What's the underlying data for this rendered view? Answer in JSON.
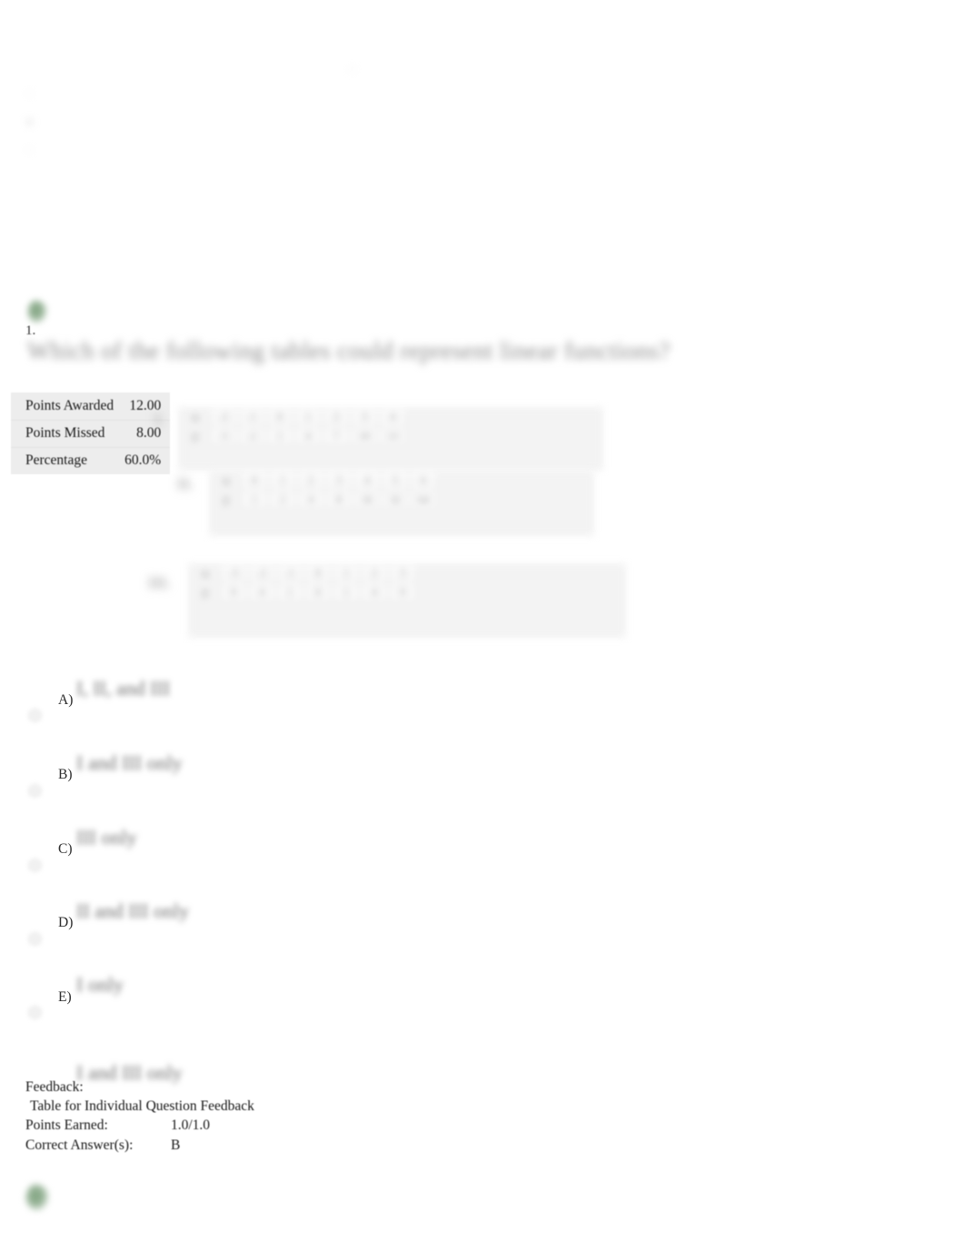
{
  "document": {
    "type": "quiz-review",
    "background_color": "#ffffff"
  },
  "top_artifacts": {
    "center_mark": "▫",
    "left_marks": [
      "▫",
      "▪",
      "▫"
    ]
  },
  "score_summary": {
    "rows": [
      {
        "label": "Points Awarded",
        "value": "12.00"
      },
      {
        "label": "Points Missed",
        "value": "8.00"
      },
      {
        "label": "Percentage",
        "value": "60.0%"
      }
    ]
  },
  "status_icons": {
    "top": "correct-check-icon",
    "bottom": "correct-check-icon",
    "color": "#8aab8a"
  },
  "question": {
    "number": "1.",
    "text": "Which of the following tables could represent linear functions?",
    "figures": [
      {
        "label": "I.",
        "rows": [
          [
            "x",
            "-2",
            "-1",
            "0",
            "1",
            "2",
            "3",
            "4"
          ],
          [
            "y",
            "-5",
            "-2",
            "1",
            "4",
            "7",
            "10",
            "13"
          ]
        ]
      },
      {
        "label": "II.",
        "rows": [
          [
            "x",
            "0",
            "1",
            "2",
            "3",
            "4",
            "5",
            "6"
          ],
          [
            "y",
            "1",
            "2",
            "4",
            "8",
            "16",
            "32",
            "64"
          ]
        ]
      },
      {
        "label": "III.",
        "rows": [
          [
            "x",
            "-3",
            "-2",
            "-1",
            "0",
            "1",
            "2",
            "3"
          ],
          [
            "y",
            "9",
            "4",
            "1",
            "0",
            "1",
            "4",
            "9"
          ]
        ]
      }
    ]
  },
  "options": [
    {
      "letter": "A)",
      "text": "I, II, and III",
      "selected": false
    },
    {
      "letter": "B)",
      "text": "I and III only",
      "selected": true
    },
    {
      "letter": "C)",
      "text": "III only",
      "selected": false
    },
    {
      "letter": "D)",
      "text": "II and III only",
      "selected": false
    },
    {
      "letter": "E)",
      "text": "I only",
      "selected": false
    }
  ],
  "selected_answer_echo": "I and III only",
  "feedback": {
    "heading": "Feedback:",
    "table_caption": " Table for Individual Question Feedback",
    "points_earned_label": "Points Earned:",
    "points_earned_value": "1.0/1.0",
    "correct_answer_label": "Correct Answer(s):",
    "correct_answer_value": "B"
  }
}
